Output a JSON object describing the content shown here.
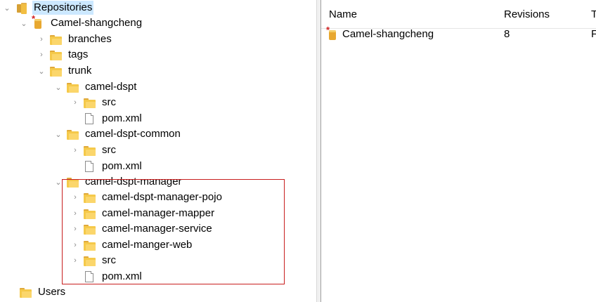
{
  "tree": {
    "items": [
      {
        "label": "Repositories",
        "icon": "repositories-icon",
        "expander": "expanded",
        "selected": true
      },
      {
        "label": "Camel-shangcheng",
        "icon": "repository-icon",
        "expander": "expanded"
      },
      {
        "label": "branches",
        "icon": "folder-icon",
        "expander": "collapsed"
      },
      {
        "label": "tags",
        "icon": "folder-icon",
        "expander": "collapsed"
      },
      {
        "label": "trunk",
        "icon": "folder-icon",
        "expander": "expanded"
      },
      {
        "label": "camel-dspt",
        "icon": "folder-icon",
        "expander": "expanded"
      },
      {
        "label": "src",
        "icon": "folder-icon",
        "expander": "collapsed"
      },
      {
        "label": "pom.xml",
        "icon": "file-icon",
        "expander": "none"
      },
      {
        "label": "camel-dspt-common",
        "icon": "folder-icon",
        "expander": "expanded"
      },
      {
        "label": "src",
        "icon": "folder-icon",
        "expander": "collapsed"
      },
      {
        "label": "pom.xml",
        "icon": "file-icon",
        "expander": "none"
      },
      {
        "label": "camel-dspt-manager",
        "icon": "folder-icon",
        "expander": "expanded"
      },
      {
        "label": "camel-dspt-manager-pojo",
        "icon": "folder-icon",
        "expander": "collapsed"
      },
      {
        "label": "camel-manager-mapper",
        "icon": "folder-icon",
        "expander": "collapsed"
      },
      {
        "label": "camel-manager-service",
        "icon": "folder-icon",
        "expander": "collapsed"
      },
      {
        "label": "camel-manger-web",
        "icon": "folder-icon",
        "expander": "collapsed"
      },
      {
        "label": "src",
        "icon": "folder-icon",
        "expander": "collapsed"
      },
      {
        "label": "pom.xml",
        "icon": "file-icon",
        "expander": "none"
      },
      {
        "label": "Users",
        "icon": "folder-icon",
        "expander": "none"
      }
    ]
  },
  "list": {
    "columns": [
      "Name",
      "Revisions",
      "T"
    ],
    "rows": [
      {
        "name": "Camel-shangcheng",
        "revisions": "8",
        "extra": "F",
        "icon": "repository-icon"
      }
    ]
  },
  "colors": {
    "selection": "#cce8ff",
    "highlight_border": "#c81e1e",
    "folder": "#f5c94a"
  }
}
